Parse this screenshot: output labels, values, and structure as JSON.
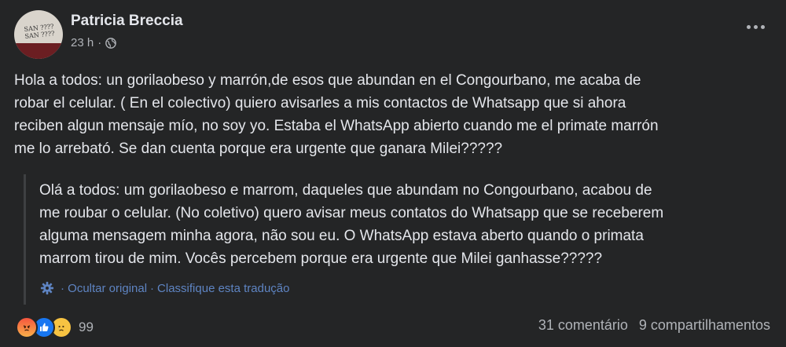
{
  "post": {
    "author": "Patricia Breccia",
    "time": "23 h",
    "separator": "·",
    "avatar_text": "SAN ???? SAN ????",
    "text_lines": [
      "Hola a todos: un gorilaobeso y marrón,de esos que abundan en el Congourbano, me acaba de",
      "robar el celular. ( En el colectivo)  quiero avisarles a mis contactos de Whatsapp que si ahora",
      "reciben algun mensaje mío, no soy yo. Estaba el WhatsApp abierto cuando me el primate marrón",
      "me lo arrebató. Se dan cuenta porque era urgente que ganara Milei?????"
    ]
  },
  "translation": {
    "text_lines": [
      "Olá a todos: um gorilaobeso e marrom, daqueles que abundam no Congourbano, acabou de",
      "me roubar o celular. (No coletivo) quero avisar meus contatos do Whatsapp que se receberem",
      "alguma mensagem minha agora, não sou eu. O WhatsApp estava aberto quando o primata",
      "marrom tirou de mim. Vocês percebem porque era urgente que Milei ganhasse?????"
    ],
    "hide_original": "· Ocultar original",
    "link_separator": "·",
    "rate_translation": "Classifique esta tradução"
  },
  "footer": {
    "reaction_count": "99",
    "reactions": [
      "angry-icon",
      "like-icon",
      "sad-icon"
    ],
    "comments": "31 comentário",
    "shares": "9 compartilhamentos"
  },
  "colors": {
    "background": "#242526",
    "text": "#e4e6eb",
    "secondary": "#b0b3b8",
    "link": "#5e84c2"
  }
}
